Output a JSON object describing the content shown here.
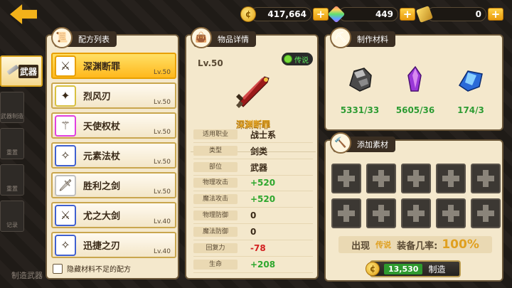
{
  "currency": {
    "gold": "417,664",
    "gems": "449",
    "tickets": "0"
  },
  "tabs": [
    {
      "label": "武器",
      "active": true
    },
    {
      "label": "武器制造",
      "active": false
    },
    {
      "label": "重置",
      "active": false
    },
    {
      "label": "重置",
      "active": false
    },
    {
      "label": "记录",
      "active": false
    }
  ],
  "recipe_panel": {
    "title": "配方列表",
    "items": [
      {
        "name": "深渊断罪",
        "level": "Lv.50",
        "border": "#e8a000",
        "icon": "⚔"
      },
      {
        "name": "烈风刃",
        "level": "Lv.50",
        "border": "#d8c040",
        "icon": "✦"
      },
      {
        "name": "天使权杖",
        "level": "Lv.50",
        "border": "#e040e0",
        "icon": "⚚"
      },
      {
        "name": "元素法杖",
        "level": "Lv.50",
        "border": "#4060d0",
        "icon": "✧"
      },
      {
        "name": "胜利之剑",
        "level": "Lv.50",
        "border": "#c0c0c0",
        "icon": "🗡"
      },
      {
        "name": "尤之大剑",
        "level": "Lv.40",
        "border": "#4060d0",
        "icon": "⚔"
      },
      {
        "name": "迅捷之刃",
        "level": "Lv.40",
        "border": "#4060d0",
        "icon": "✧"
      }
    ],
    "hide_insufficient_label": "隐藏材料不足的配方"
  },
  "detail_panel": {
    "title": "物品详情",
    "level": "Lv.50",
    "rarity": "传说",
    "weapon_name": "深渊断罪",
    "info": [
      {
        "label": "适用职业",
        "value": "战士系"
      },
      {
        "label": "类型",
        "value": "剑类"
      },
      {
        "label": "部位",
        "value": "武器"
      }
    ],
    "stats": [
      {
        "label": "物理攻击",
        "value": "+520",
        "kind": "pos"
      },
      {
        "label": "魔法攻击",
        "value": "+520",
        "kind": "pos"
      },
      {
        "label": "物理防御",
        "value": "0",
        "kind": ""
      },
      {
        "label": "魔法防御",
        "value": "0",
        "kind": ""
      },
      {
        "label": "回复力",
        "value": "-78",
        "kind": "neg"
      },
      {
        "label": "生命",
        "value": "+208",
        "kind": "pos"
      }
    ]
  },
  "material_panel": {
    "title": "制作材料",
    "items": [
      {
        "count": "5331/33",
        "kind": "ore"
      },
      {
        "count": "5605/36",
        "kind": "purple-crystal"
      },
      {
        "count": "174/3",
        "kind": "blue-crystal"
      }
    ]
  },
  "add_panel": {
    "title": "添加素材",
    "slot_count": 10,
    "chance_prefix": "出现",
    "chance_grade": "传说",
    "chance_text": "装备几率:",
    "chance_pct": "100%",
    "craft_cost": "13,530",
    "craft_label": "制造"
  },
  "footer": {
    "text": "制造武器"
  }
}
